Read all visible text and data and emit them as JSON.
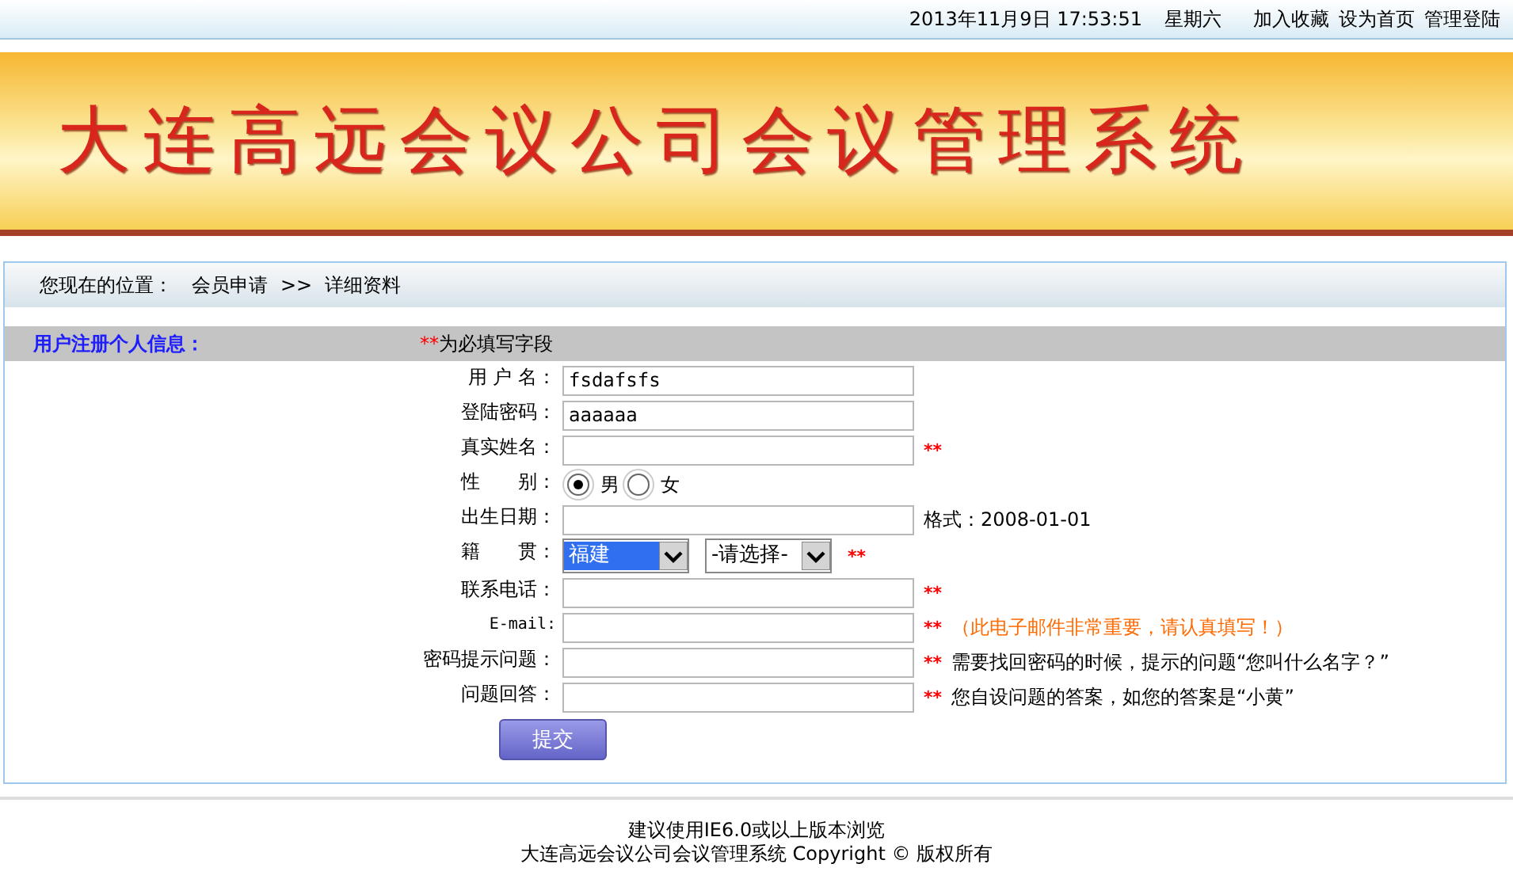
{
  "top_bar": {
    "datetime": "2013年11月9日 17:53:51",
    "weekday": "星期六",
    "links": [
      "加入收藏",
      "设为首页",
      "管理登陆"
    ]
  },
  "banner": {
    "title": "大连高远会议公司会议管理系统"
  },
  "breadcrumb": {
    "label": "您现在的位置：",
    "path": [
      "会员申请",
      "详细资料"
    ],
    "separator": ">>"
  },
  "form": {
    "heading": "用户注册个人信息：",
    "required_note": {
      "mark": "**",
      "text": "为必填写字段"
    },
    "fields": [
      {
        "kind": "text",
        "label": "用 户 名：",
        "value": "fsdafsfs"
      },
      {
        "kind": "text",
        "label": "登陆密码：",
        "value": "aaaaaa"
      },
      {
        "kind": "text",
        "label": "真实姓名：",
        "required_mark": "**"
      },
      {
        "kind": "radio",
        "label": "性　　别：",
        "options": [
          {
            "label": "男",
            "selected": true
          },
          {
            "label": "女",
            "selected": false
          }
        ]
      },
      {
        "kind": "text",
        "label": "出生日期：",
        "hint": "格式：2008-01-01",
        "hint_emphasis": false
      },
      {
        "kind": "select",
        "label": "籍　　贯：",
        "selects": [
          {
            "value": "福建",
            "highlighted": true
          },
          {
            "value": "-请选择-",
            "highlighted": false
          }
        ],
        "required_mark": "**"
      },
      {
        "kind": "text",
        "label": "联系电话：",
        "required_mark": "**"
      },
      {
        "kind": "text",
        "label": "E-mail:",
        "mono_label": true,
        "required_mark": "**",
        "hint": "（此电子邮件非常重要，请认真填写！）",
        "hint_emphasis": true
      },
      {
        "kind": "text",
        "label": "密码提示问题：",
        "required_mark": "**",
        "hint": "需要找回密码的时候，提示的问题“您叫什么名字？”",
        "hint_emphasis": false
      },
      {
        "kind": "text",
        "label": "问题回答：",
        "required_mark": "**",
        "hint": "您自设问题的答案，如您的答案是“小黄”",
        "hint_emphasis": false
      }
    ],
    "submit": "提交"
  },
  "footer": [
    "建议使用IE6.0或以上版本浏览",
    "大连高远会议公司会议管理系统 Copyright © 版权所有"
  ]
}
